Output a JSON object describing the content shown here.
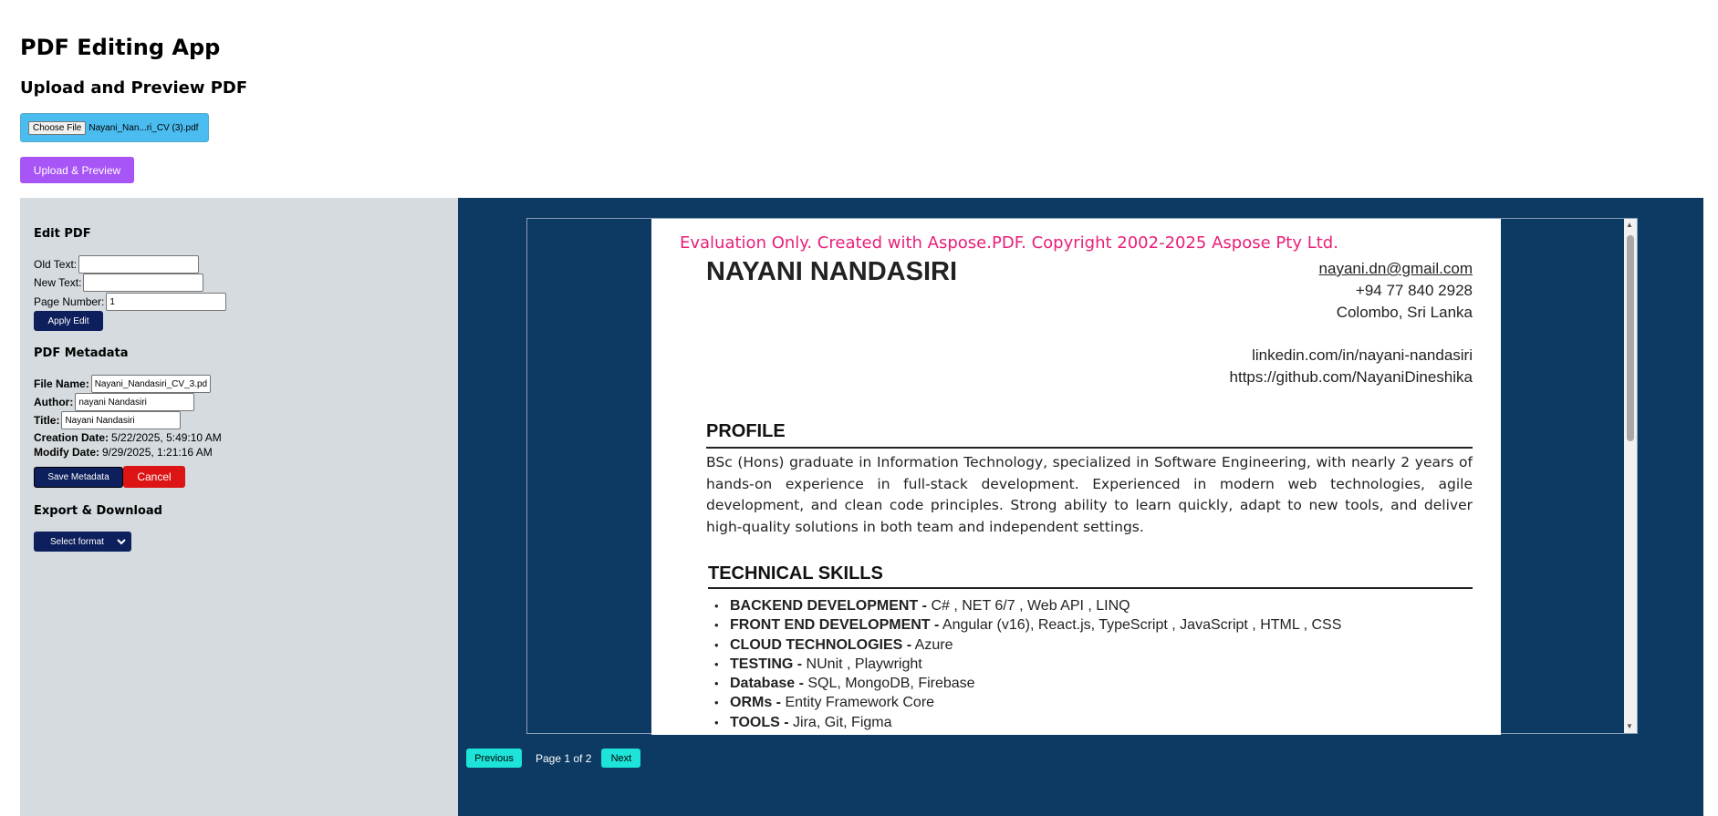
{
  "app": {
    "title": "PDF Editing App",
    "section_title": "Upload and Preview PDF"
  },
  "upload": {
    "choose_label": "Choose File",
    "file_name": "Nayani_Nan...ri_CV (3).pdf",
    "upload_label": "Upload & Preview"
  },
  "edit": {
    "heading": "Edit PDF",
    "old_text_label": "Old Text:",
    "old_text_value": "",
    "new_text_label": "New Text:",
    "new_text_value": "",
    "page_number_label": "Page Number:",
    "page_number_value": "1",
    "apply_label": "Apply Edit"
  },
  "metadata": {
    "heading": "PDF Metadata",
    "file_name_label": "File Name:",
    "file_name_value": "Nayani_Nandasiri_CV_3.pdf",
    "author_label": "Author:",
    "author_value": "nayani Nandasiri",
    "title_label": "Title:",
    "title_value": "Nayani Nandasiri",
    "creation_label": "Creation Date:",
    "creation_value": "5/22/2025, 5:49:10 AM",
    "modify_label": "Modify Date:",
    "modify_value": "9/29/2025, 1:21:16 AM",
    "save_label": "Save Metadata",
    "cancel_label": "Cancel"
  },
  "export": {
    "heading": "Export & Download",
    "select_label": "Select format"
  },
  "preview": {
    "watermark": "Evaluation Only. Created with Aspose.PDF. Copyright 2002-2025 Aspose Pty Ltd.",
    "name": "NAYANI NANDASIRI",
    "email": "nayani.dn@gmail.com",
    "phone": "+94 77 840 2928",
    "location": "Colombo, Sri Lanka",
    "linkedin": "linkedin.com/in/nayani-nandasiri",
    "github": "https://github.com/NayaniDineshika",
    "profile_heading": "PROFILE",
    "profile_text": "BSc (Hons) graduate in Information Technology, specialized in Software Engineering, with nearly 2 years of hands-on experience in full-stack development. Experienced in modern web technologies, agile development, and clean code principles. Strong ability to learn quickly, adapt to new tools, and deliver high-quality solutions in both team and independent settings.",
    "skills_heading": "TECHNICAL SKILLS",
    "skills": [
      {
        "label": "BACKEND DEVELOPMENT  -",
        "value": " C# ,  NET 6/7  , Web API , LINQ"
      },
      {
        "label": "FRONT END DEVELOPMENT -",
        "value": " Angular (v16), React.js, TypeScript , JavaScript , HTML , CSS"
      },
      {
        "label": "CLOUD TECHNOLOGIES -",
        "value": " Azure"
      },
      {
        "label": "TESTING -",
        "value": " NUnit , Playwright"
      },
      {
        "label": "Database -",
        "value": " SQL, MongoDB, Firebase"
      },
      {
        "label": "ORMs -",
        "value": " Entity Framework Core"
      },
      {
        "label": "TOOLS -",
        "value": "  Jira, Git, Figma"
      }
    ]
  },
  "pagination": {
    "prev_label": "Previous",
    "page_info": "Page 1 of 2",
    "next_label": "Next"
  }
}
